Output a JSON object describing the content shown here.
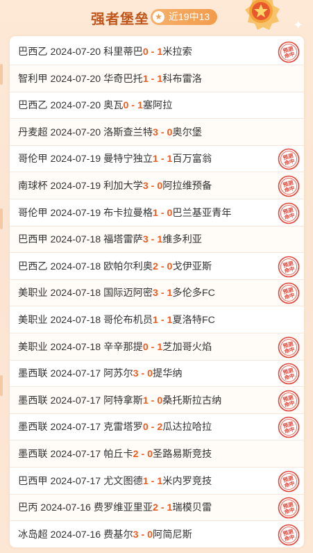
{
  "header": {
    "title": "强者堡垒",
    "badge": "近19中13"
  },
  "stamp_text": "预测命中",
  "colors": {
    "accent": "#f05a1c",
    "title": "#c0561b",
    "stamp": "#e2453a"
  },
  "matches": [
    {
      "league": "巴西乙",
      "date": "2024-07-20",
      "home": "科里蒂巴",
      "hs": "0",
      "as": "1",
      "away": "米拉索",
      "hit": true
    },
    {
      "league": "智利甲",
      "date": "2024-07-20",
      "home": "华奇巴托",
      "hs": "1",
      "as": "1",
      "away": "科布雷洛",
      "hit": false
    },
    {
      "league": "巴西乙",
      "date": "2024-07-20",
      "home": "奥瓦",
      "hs": "0",
      "as": "1",
      "away": "塞阿拉",
      "hit": false
    },
    {
      "league": "丹麦超",
      "date": "2024-07-20",
      "home": "洛斯查兰特",
      "hs": "3",
      "as": "0",
      "away": "奥尔堡",
      "hit": false
    },
    {
      "league": "哥伦甲",
      "date": "2024-07-19",
      "home": "曼特宁独立",
      "hs": "1",
      "as": "1",
      "away": "百万富翁",
      "hit": true
    },
    {
      "league": "南球杯",
      "date": "2024-07-19",
      "home": "利加大学",
      "hs": "3",
      "as": "0",
      "away": "阿拉维预备",
      "hit": true
    },
    {
      "league": "哥伦甲",
      "date": "2024-07-19",
      "home": "布卡拉曼格",
      "hs": "1",
      "as": "0",
      "away": "巴兰基亚青年",
      "hit": true
    },
    {
      "league": "巴西甲",
      "date": "2024-07-18",
      "home": "福塔雷萨",
      "hs": "3",
      "as": "1",
      "away": "维多利亚",
      "hit": false
    },
    {
      "league": "巴西乙",
      "date": "2024-07-18",
      "home": "欧帕尔利奥",
      "hs": "2",
      "as": "0",
      "away": "戈伊亚斯",
      "hit": true
    },
    {
      "league": "美职业",
      "date": "2024-07-18",
      "home": "国际迈阿密",
      "hs": "3",
      "as": "1",
      "away": "多伦多FC",
      "hit": true
    },
    {
      "league": "美职业",
      "date": "2024-07-18",
      "home": "哥伦布机员",
      "hs": "1",
      "as": "1",
      "away": "夏洛特FC",
      "hit": false
    },
    {
      "league": "美职业",
      "date": "2024-07-18",
      "home": "辛辛那提",
      "hs": "0",
      "as": "1",
      "away": "芝加哥火焰",
      "hit": true
    },
    {
      "league": "墨西联",
      "date": "2024-07-17",
      "home": "阿苏尔",
      "hs": "3",
      "as": "0",
      "away": "提华纳",
      "hit": true
    },
    {
      "league": "墨西联",
      "date": "2024-07-17",
      "home": "阿特拿斯",
      "hs": "1",
      "as": "0",
      "away": "桑托斯拉古纳",
      "hit": true
    },
    {
      "league": "墨西联",
      "date": "2024-07-17",
      "home": "克雷塔罗",
      "hs": "0",
      "as": "2",
      "away": "瓜达拉哈拉",
      "hit": true
    },
    {
      "league": "墨西联",
      "date": "2024-07-17",
      "home": "帕丘卡",
      "hs": "2",
      "as": "0",
      "away": "圣路易斯竞技",
      "hit": false
    },
    {
      "league": "巴西甲",
      "date": "2024-07-17",
      "home": "尤文图德",
      "hs": "1",
      "as": "1",
      "away": "米内罗竞技",
      "hit": true
    },
    {
      "league": "巴丙",
      "date": "2024-07-16",
      "home": "费罗维亚里亚",
      "hs": "2",
      "as": "1",
      "away": "瑞模贝雷",
      "hit": true
    },
    {
      "league": "冰岛超",
      "date": "2024-07-16",
      "home": "费基尔",
      "hs": "3",
      "as": "0",
      "away": "阿简尼斯",
      "hit": true
    }
  ]
}
